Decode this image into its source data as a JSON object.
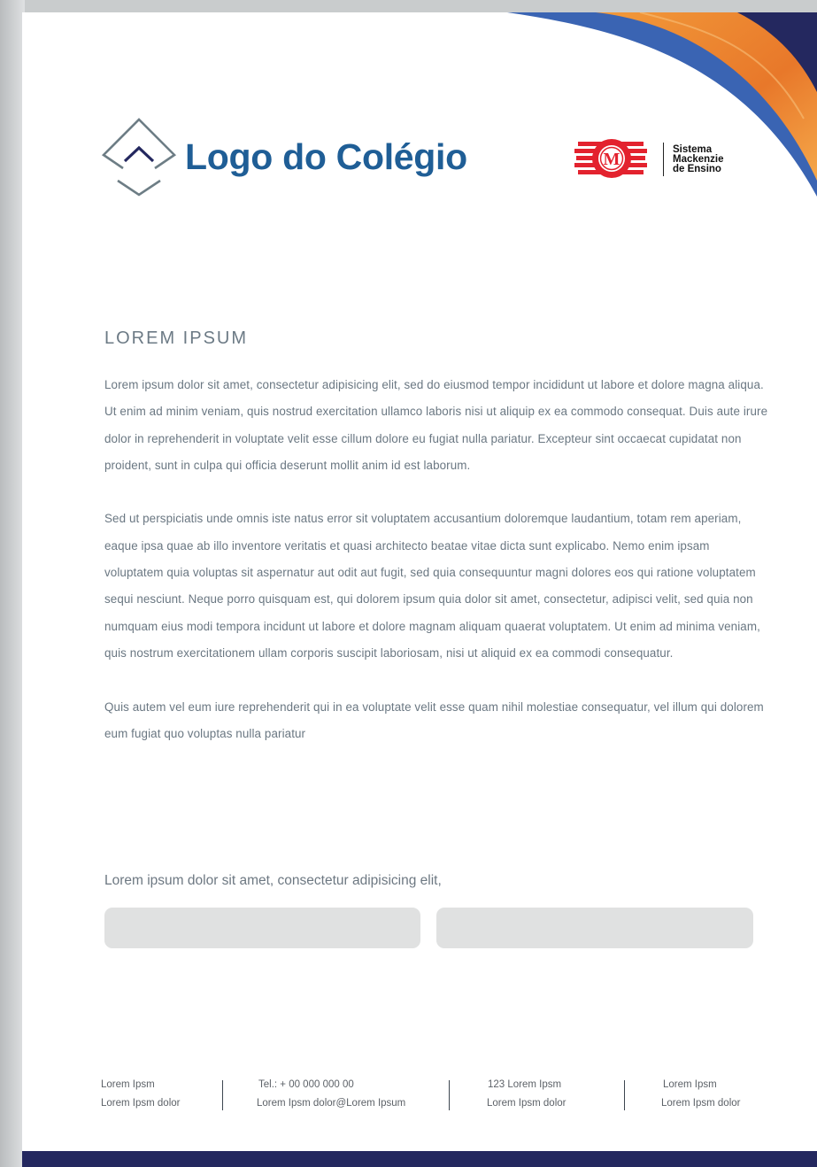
{
  "header": {
    "school_logo_text": "Logo do Colégio",
    "partner_logo": {
      "line1": "Sistema",
      "line2": "Mackenzie",
      "line3": "de Ensino"
    }
  },
  "content": {
    "heading": "LOREM IPSUM",
    "paragraphs": [
      "Lorem ipsum dolor sit amet, consectetur adipisicing elit, sed do eiusmod tempor incididunt ut labore et dolore magna aliqua. Ut enim ad minim veniam, quis nostrud exercitation ullamco laboris nisi ut aliquip ex ea commodo consequat. Duis aute irure dolor in reprehenderit in voluptate velit esse cillum dolore eu fugiat nulla pariatur. Excepteur sint occaecat cupidatat non proident, sunt in culpa qui officia deserunt mollit anim id est laborum.",
      "Sed ut perspiciatis unde omnis iste natus error sit voluptatem accusantium doloremque laudantium, totam rem aperiam, eaque ipsa quae ab illo inventore veritatis et quasi architecto beatae vitae dicta sunt explicabo. Nemo enim ipsam voluptatem quia voluptas sit aspernatur aut odit aut fugit, sed quia consequuntur magni dolores eos qui ratione voluptatem sequi nesciunt. Neque porro quisquam est, qui dolorem ipsum quia dolor sit amet, consectetur, adipisci velit, sed quia non numquam eius modi tempora incidunt ut labore et dolore magnam aliquam quaerat voluptatem. Ut enim ad minima veniam, quis nostrum exercitationem ullam corporis suscipit laboriosam, nisi ut aliquid ex ea commodi consequatur.",
      "Quis autem vel eum iure reprehenderit qui in ea voluptate velit esse quam nihil molestiae consequatur, vel illum qui dolorem eum fugiat quo voluptas nulla pariatur"
    ],
    "signature_prompt": "Lorem ipsum dolor sit amet, consectetur adipisicing elit,"
  },
  "footer": {
    "columns": [
      {
        "line1": "Lorem Ipsm",
        "line2": "Lorem Ipsm dolor"
      },
      {
        "line1": "Tel.: + 00 000 000 00",
        "line2": "Lorem Ipsm dolor@Lorem Ipsum"
      },
      {
        "line1": "123 Lorem Ipsm",
        "line2": "Lorem Ipsm dolor"
      },
      {
        "line1": "Lorem Ipsm",
        "line2": "Lorem Ipsm dolor"
      }
    ]
  },
  "colors": {
    "school_blue": "#1f5e96",
    "accent_navy": "#24285f",
    "accent_blue": "#3a64b3",
    "accent_orange": "#ef8a2a",
    "mackenzie_red": "#e3222e"
  },
  "icons": [
    "diamond-chevron-logo-icon",
    "mackenzie-emblem-icon"
  ]
}
